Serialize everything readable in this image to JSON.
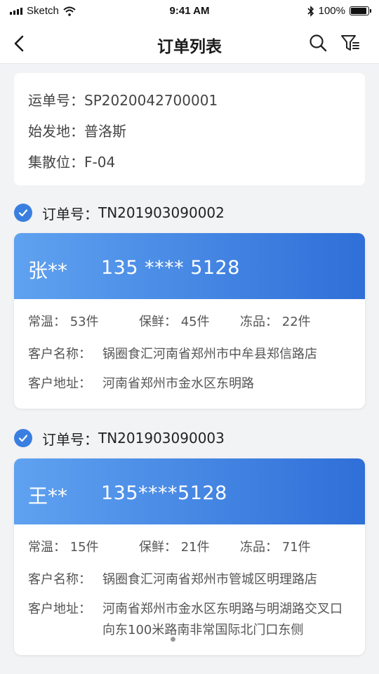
{
  "status": {
    "carrier": "Sketch",
    "time": "9:41 AM",
    "battery_text": "100%",
    "battery_level": 1.0
  },
  "nav": {
    "title": "订单列表",
    "back_icon": "chevron-left-icon",
    "search_icon": "search-icon",
    "filter_icon": "filter-icon"
  },
  "waybill": {
    "number_label": "运单号：",
    "number": "SP2020042700001",
    "origin_label": "始发地：",
    "origin": "普洛斯",
    "station_label": "集散位：",
    "station": "F-04"
  },
  "orders": [
    {
      "order_label": "订单号：",
      "order_no": "TN201903090002",
      "name": "张**",
      "phone": "135 **** 5128",
      "normal_label": "常温：",
      "normal": "53件",
      "fresh_label": "保鲜：",
      "fresh": "45件",
      "frozen_label": "冻品：",
      "frozen": "22件",
      "customer_label": "客户名称：",
      "customer": "锅圈食汇河南省郑州市中牟县郑信路店",
      "address_label": "客户地址：",
      "address": "河南省郑州市金水区东明路"
    },
    {
      "order_label": "订单号：",
      "order_no": "TN201903090003",
      "name": "王**",
      "phone": "135****5128",
      "normal_label": "常温：",
      "normal": "15件",
      "fresh_label": "保鲜：",
      "fresh": "21件",
      "frozen_label": "冻品：",
      "frozen": "71件",
      "customer_label": "客户名称：",
      "customer": "锅圈食汇河南省郑州市管城区明理路店",
      "address_label": "客户地址：",
      "address": "河南省郑州市金水区东明路与明湖路交叉口向东100米路南非常国际北门口东侧"
    }
  ],
  "colors": {
    "accent": "#3a7fe0",
    "band_start": "#5fa2f0",
    "band_end": "#2f6fd8"
  }
}
